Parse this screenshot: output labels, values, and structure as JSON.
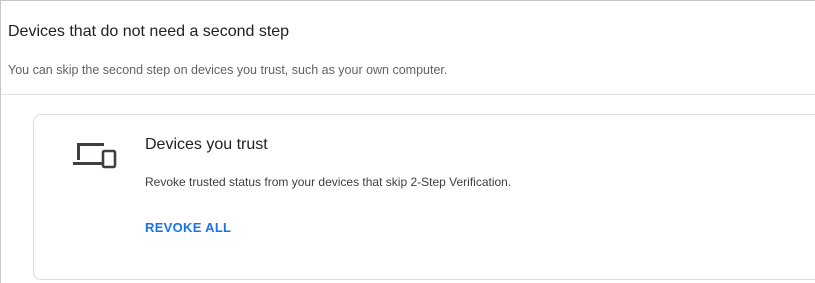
{
  "section": {
    "title": "Devices that do not need a second step",
    "description": "You can skip the second step on devices you trust, such as your own computer."
  },
  "card": {
    "icon": "devices-icon",
    "title": "Devices you trust",
    "description": "Revoke trusted status from your devices that skip 2-Step Verification.",
    "action_label": "REVOKE ALL"
  },
  "colors": {
    "accent": "#1a73e8",
    "text": "#202124",
    "secondary_text": "#5f6368",
    "border": "#dadce0"
  }
}
